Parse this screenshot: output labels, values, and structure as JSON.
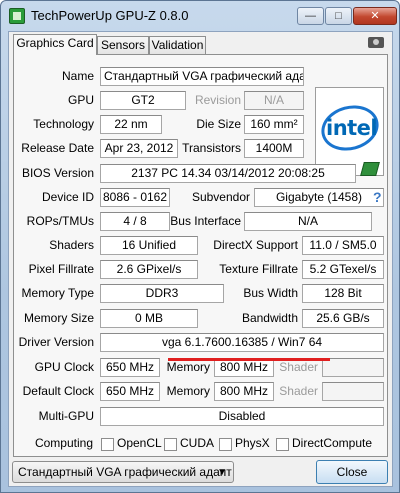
{
  "window": {
    "title": "TechPowerUp GPU-Z 0.8.0"
  },
  "titlebar_buttons": {
    "minimize": "—",
    "maximize": "□",
    "close": "✕"
  },
  "tabs": [
    "Graphics Card",
    "Sensors",
    "Validation"
  ],
  "fields": {
    "name": {
      "label": "Name",
      "value": "Стандартный VGA графический адап..."
    },
    "gpu": {
      "label": "GPU",
      "value": "GT2"
    },
    "revision": {
      "label": "Revision",
      "value": "N/A"
    },
    "technology": {
      "label": "Technology",
      "value": "22 nm"
    },
    "die_size": {
      "label": "Die Size",
      "value": "160 mm²"
    },
    "release_date": {
      "label": "Release Date",
      "value": "Apr 23, 2012"
    },
    "transistors": {
      "label": "Transistors",
      "value": "1400M"
    },
    "bios_version": {
      "label": "BIOS Version",
      "value": "2137 PC 14.34 03/14/2012 20:08:25"
    },
    "device_id": {
      "label": "Device ID",
      "value": "8086 - 0162"
    },
    "subvendor": {
      "label": "Subvendor",
      "value": "Gigabyte (1458)"
    },
    "rops_tmus": {
      "label": "ROPs/TMUs",
      "value": "4 / 8"
    },
    "bus_interface": {
      "label": "Bus Interface",
      "value": "N/A"
    },
    "shaders": {
      "label": "Shaders",
      "value": "16 Unified"
    },
    "directx_support": {
      "label": "DirectX Support",
      "value": "11.0 / SM5.0"
    },
    "pixel_fillrate": {
      "label": "Pixel Fillrate",
      "value": "2.6 GPixel/s"
    },
    "texture_fillrate": {
      "label": "Texture Fillrate",
      "value": "5.2 GTexel/s"
    },
    "memory_type": {
      "label": "Memory Type",
      "value": "DDR3"
    },
    "bus_width": {
      "label": "Bus Width",
      "value": "128 Bit"
    },
    "memory_size": {
      "label": "Memory Size",
      "value": "0 MB"
    },
    "bandwidth": {
      "label": "Bandwidth",
      "value": "25.6 GB/s"
    },
    "driver_version": {
      "label": "Driver Version",
      "value": "vga 6.1.7600.16385 / Win7 64"
    },
    "gpu_clock": {
      "label": "GPU Clock",
      "value": "650 MHz",
      "memory_label": "Memory",
      "memory_value": "800 MHz",
      "shader_label": "Shader",
      "shader_value": ""
    },
    "default_clock": {
      "label": "Default Clock",
      "value": "650 MHz",
      "memory_label": "Memory",
      "memory_value": "800 MHz",
      "shader_label": "Shader",
      "shader_value": ""
    },
    "multi_gpu": {
      "label": "Multi-GPU",
      "value": "Disabled"
    },
    "computing": {
      "label": "Computing",
      "options": [
        "OpenCL",
        "CUDA",
        "PhysX",
        "DirectCompute"
      ]
    }
  },
  "logo": {
    "text": "intel"
  },
  "help": {
    "text": "?"
  },
  "footer": {
    "selected_adapter": "Стандартный VGA графический адапт",
    "close_label": "Close"
  },
  "colors": {
    "intel_blue": "#0068b5",
    "highlight_underline": "#e01f1f"
  }
}
